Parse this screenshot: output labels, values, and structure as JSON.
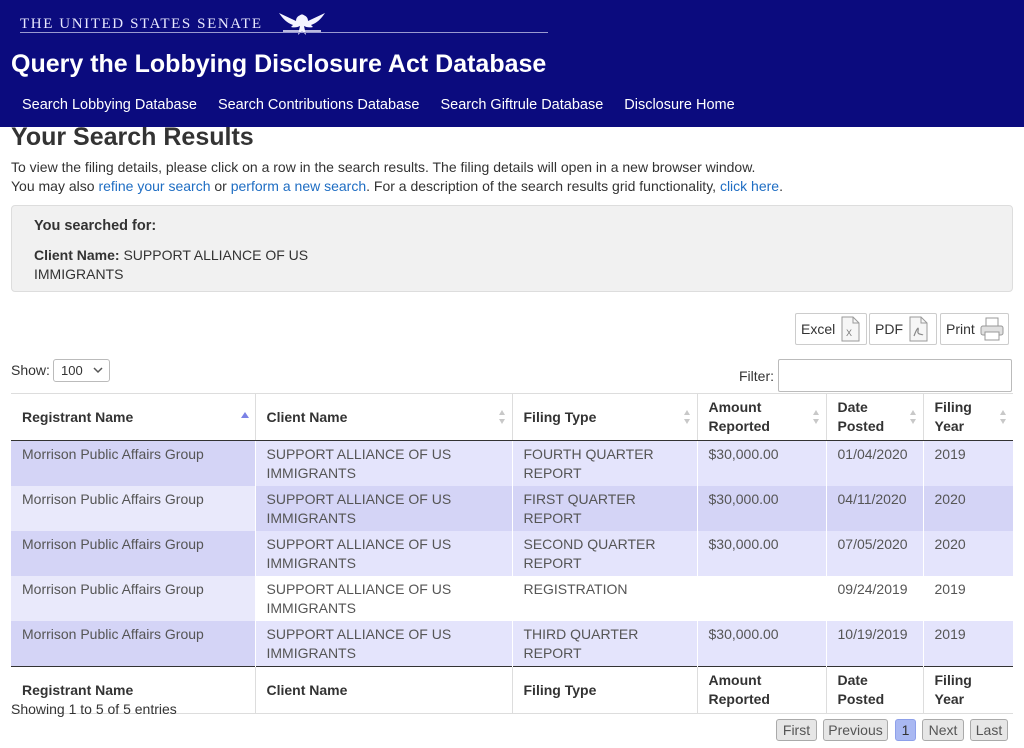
{
  "header": {
    "senate_label": "THE UNITED STATES SENATE",
    "db_title": "Query the Lobbying Disclosure Act Database",
    "nav": [
      "Search Lobbying Database",
      "Search Contributions Database",
      "Search Giftrule Database",
      "Disclosure Home"
    ]
  },
  "page": {
    "title": "Your Search Results",
    "intro_line1": "To view the filing details, please click on a row in the search results. The filing details will open in a new browser window.",
    "intro_pre": "You may also ",
    "refine_link": "refine your search",
    "or_text": " or ",
    "new_link": "perform a new search",
    "desc_text": ". For a description of the search results grid functionality, ",
    "click_link": "click here",
    "period": "."
  },
  "searched": {
    "label": "You searched for:",
    "criteria_label": "Client Name:",
    "criteria_value": " SUPPORT ALLIANCE OF US IMMIGRANTS"
  },
  "exports": {
    "excel": "Excel",
    "pdf": "PDF",
    "print": "Print"
  },
  "controls": {
    "show_label": "Show:",
    "show_value": "100",
    "filter_label": "Filter:",
    "filter_value": ""
  },
  "table": {
    "columns": [
      "Registrant Name",
      "Client Name",
      "Filing Type",
      "Amount Reported",
      "Date Posted",
      "Filing Year"
    ],
    "rows": [
      [
        "Morrison Public Affairs Group",
        "SUPPORT ALLIANCE OF US IMMIGRANTS",
        "FOURTH QUARTER REPORT",
        "$30,000.00",
        "01/04/2020",
        "2019"
      ],
      [
        "Morrison Public Affairs Group",
        "SUPPORT ALLIANCE OF US IMMIGRANTS",
        "FIRST QUARTER REPORT",
        "$30,000.00",
        "04/11/2020",
        "2020"
      ],
      [
        "Morrison Public Affairs Group",
        "SUPPORT ALLIANCE OF US IMMIGRANTS",
        "SECOND QUARTER REPORT",
        "$30,000.00",
        "07/05/2020",
        "2020"
      ],
      [
        "Morrison Public Affairs Group",
        "SUPPORT ALLIANCE OF US IMMIGRANTS",
        "REGISTRATION",
        "",
        "09/24/2019",
        "2019"
      ],
      [
        "Morrison Public Affairs Group",
        "SUPPORT ALLIANCE OF US IMMIGRANTS",
        "THIRD QUARTER REPORT",
        "$30,000.00",
        "10/19/2019",
        "2019"
      ]
    ],
    "sorted_column": "Registrant Name",
    "sort_direction": "ascending"
  },
  "footer": {
    "info": "Showing 1 to 5 of 5 entries",
    "pager": {
      "first": "First",
      "previous": "Previous",
      "current": "1",
      "next": "Next",
      "last": "Last"
    }
  },
  "colors": {
    "header_bg": "#0b0b7e",
    "link": "#1e6dc3",
    "row_highlight": "#e4e4fc",
    "pager_current": "#a9b8f2"
  }
}
